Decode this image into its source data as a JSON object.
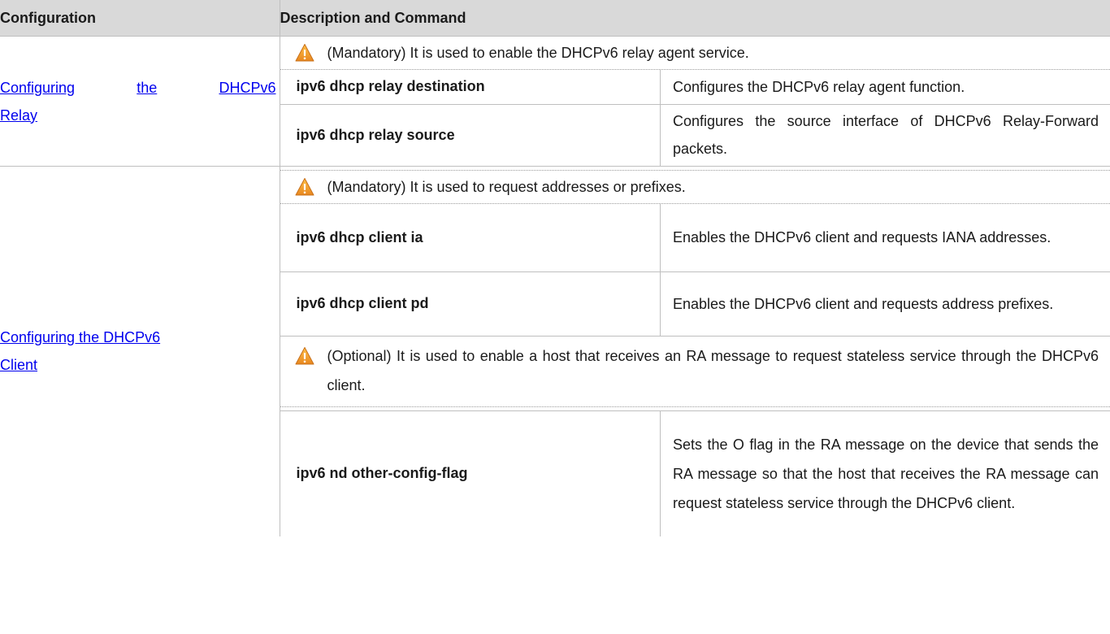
{
  "header": {
    "col_configuration": "Configuration",
    "col_description": "Description and Command"
  },
  "relay": {
    "link_words": [
      "Configuring",
      "the",
      "DHCPv6"
    ],
    "link_last": "Relay",
    "note_icon": "warning-triangle-icon",
    "note": "(Mandatory) It is used to enable the DHCPv6 relay agent service.",
    "commands": [
      {
        "cmd": "ipv6 dhcp relay destination",
        "desc": "Configures the DHCPv6 relay agent function."
      },
      {
        "cmd": "ipv6 dhcp relay source",
        "desc": "Configures the source interface of DHCPv6 Relay-Forward packets."
      }
    ]
  },
  "client": {
    "link_line1": "Configuring the DHCPv6",
    "link_line2": "Client",
    "note1_icon": "warning-triangle-icon",
    "note1": "(Mandatory) It is used to request addresses or prefixes.",
    "commands1": [
      {
        "cmd": "ipv6 dhcp client ia",
        "desc": "Enables the DHCPv6 client and requests IANA addresses."
      },
      {
        "cmd": "ipv6 dhcp client pd",
        "desc": "Enables the DHCPv6 client and requests address prefixes."
      }
    ],
    "note2_icon": "warning-triangle-icon",
    "note2": "(Optional) It is used to enable a host that receives an RA message to request stateless service through the DHCPv6 client.",
    "commands2": [
      {
        "cmd": "ipv6 nd other-config-flag",
        "desc": "Sets the O flag in the RA message on the device that sends the RA message so that the host that receives the RA message can request stateless service through the DHCPv6 client."
      }
    ]
  },
  "colors": {
    "header_bg": "#d9d9d9",
    "link": "#0000ee",
    "warning": "#f5a623"
  }
}
